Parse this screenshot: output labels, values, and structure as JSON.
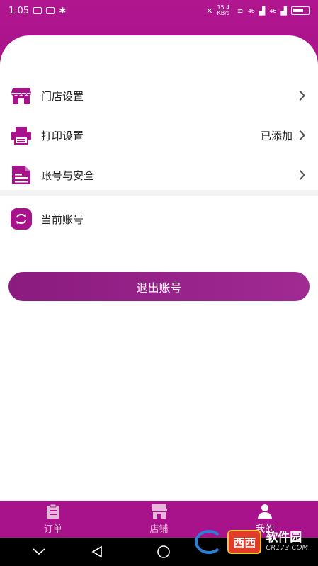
{
  "status_bar": {
    "time": "1:05",
    "speed": "15.4 KB/s",
    "signal": "46",
    "signal2": "46"
  },
  "menu": [
    {
      "label": "门店设置",
      "value": "",
      "icon": "store-icon"
    },
    {
      "label": "打印设置",
      "value": "已添加",
      "icon": "printer-icon"
    },
    {
      "label": "账号与安全",
      "value": "",
      "icon": "document-icon"
    }
  ],
  "current_account": {
    "label": "当前账号",
    "icon": "switch-account-icon"
  },
  "logout_label": "退出账号",
  "tabs": [
    {
      "label": "订单",
      "icon": "clipboard-icon",
      "active": false
    },
    {
      "label": "店铺",
      "icon": "shop-icon",
      "active": false
    },
    {
      "label": "我的",
      "icon": "user-icon",
      "active": true
    }
  ],
  "watermark": {
    "badge": "西西",
    "title": "软件园",
    "url": "CR173.COM"
  },
  "colors": {
    "brand": "#a8128a",
    "button": "#96238a"
  }
}
